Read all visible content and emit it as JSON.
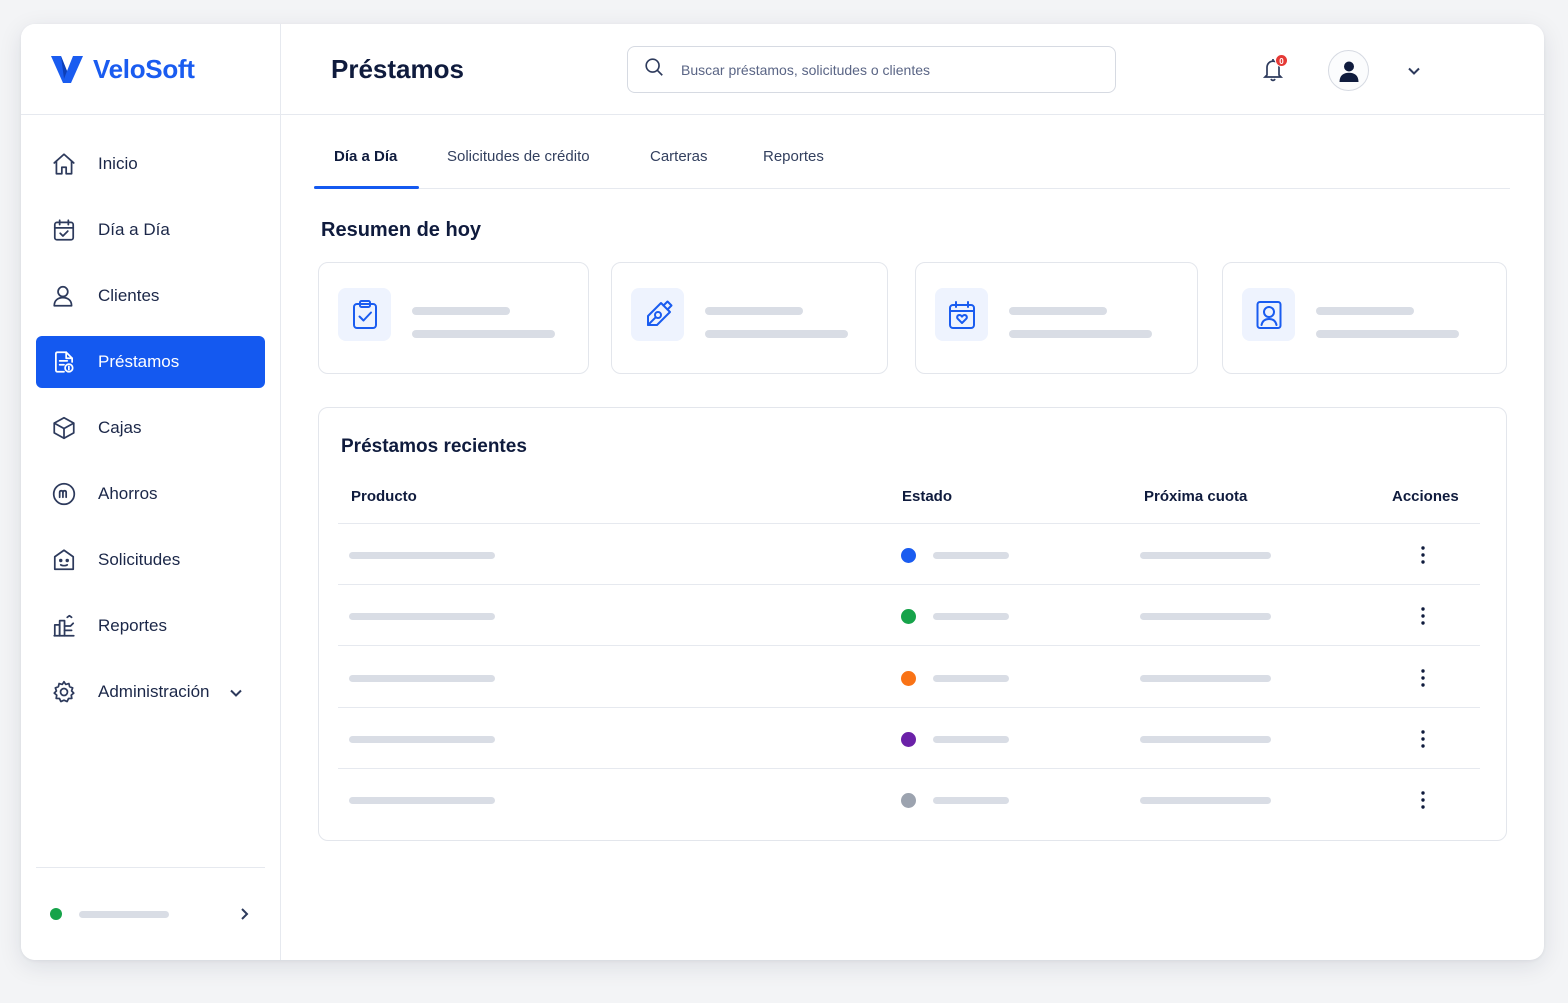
{
  "app": {
    "brand": "VeloSoft",
    "accent_color": "#1459f0"
  },
  "header": {
    "title": "Préstamos",
    "search_placeholder": "Buscar préstamos, solicitudes o clientes",
    "notification_count": "0"
  },
  "sidebar": {
    "items": [
      {
        "label": "Inicio",
        "icon": "home-icon"
      },
      {
        "label": "Día a Día",
        "icon": "calendar-check-icon"
      },
      {
        "label": "Clientes",
        "icon": "user-icon"
      },
      {
        "label": "Préstamos",
        "icon": "document-icon",
        "active": true
      },
      {
        "label": "Cajas",
        "icon": "box-icon"
      },
      {
        "label": "Ahorros",
        "icon": "savings-icon"
      },
      {
        "label": "Solicitudes",
        "icon": "request-icon"
      },
      {
        "label": "Reportes",
        "icon": "reports-icon"
      },
      {
        "label": "Administración",
        "icon": "gear-icon"
      }
    ],
    "footer_status_color": "#16a34a"
  },
  "tabs": [
    {
      "label": "Día a Día",
      "active": true
    },
    {
      "label": "Solicitudes de crédito"
    },
    {
      "label": "Carteras"
    },
    {
      "label": "Reportes"
    }
  ],
  "summary": {
    "title": "Resumen de hoy",
    "cards": [
      {
        "icon": "clipboard-check-icon"
      },
      {
        "icon": "pen-tool-icon"
      },
      {
        "icon": "calendar-heart-icon"
      },
      {
        "icon": "user-badge-icon"
      }
    ]
  },
  "recent": {
    "title": "Préstamos recientes",
    "columns": [
      "Producto",
      "Estado",
      "Próxima cuota",
      "Acciones"
    ],
    "rows": [
      {
        "status_color": "#1a5cf0"
      },
      {
        "status_color": "#16a34a"
      },
      {
        "status_color": "#f97316"
      },
      {
        "status_color": "#6b21a8"
      },
      {
        "status_color": "#9ca3af"
      }
    ]
  }
}
